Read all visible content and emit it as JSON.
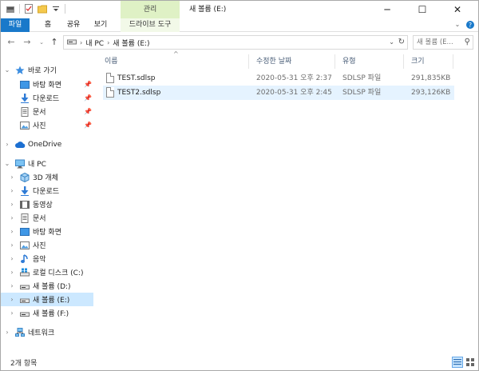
{
  "titlebar": {
    "title": "새 볼륨 (E:)",
    "context_tab": "관리",
    "minimize": "─",
    "maximize": "☐",
    "close": "✕"
  },
  "ribbon": {
    "tabs": [
      "파일",
      "홈",
      "공유",
      "보기",
      "드라이브 도구"
    ],
    "file_color": "#1979ca",
    "context_color": "#dff1c5"
  },
  "address": {
    "crumbs": [
      "내 PC",
      "새 볼륨 (E:)"
    ],
    "search_placeholder": "새 볼륨 (E..."
  },
  "nav": {
    "quick_access": "바로 가기",
    "quick_items": [
      "바탕 화면",
      "다운로드",
      "문서",
      "사진"
    ],
    "onedrive": "OneDrive",
    "this_pc": "내 PC",
    "pc_items": [
      "3D 개체",
      "다운로드",
      "동영상",
      "문서",
      "바탕 화면",
      "사진",
      "음악",
      "로컬 디스크 (C:)",
      "새 볼륨 (D:)",
      "새 볼륨 (E:)",
      "새 볼륨 (F:)"
    ],
    "network": "네트워크",
    "selected": "새 볼륨 (E:)"
  },
  "columns": {
    "name": "이름",
    "date": "수정한 날짜",
    "type": "유형",
    "size": "크기"
  },
  "files": [
    {
      "name": "TEST.sdlsp",
      "date": "2020-05-31 오후 2:37",
      "type": "SDLSP 파일",
      "size": "291,835KB"
    },
    {
      "name": "TEST2.sdlsp",
      "date": "2020-05-31 오후 2:45",
      "type": "SDLSP 파일",
      "size": "293,126KB"
    }
  ],
  "status": {
    "count": "2개 항목"
  }
}
